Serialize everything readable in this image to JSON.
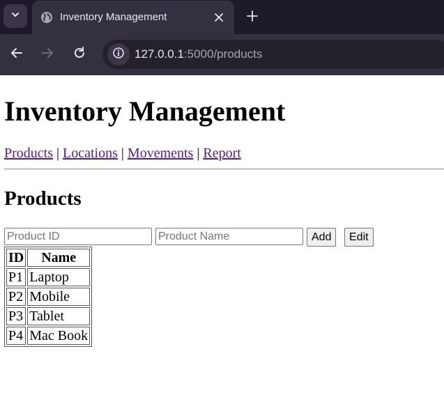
{
  "browser": {
    "tab": {
      "title": "Inventory Management",
      "favicon": "globe-icon"
    },
    "url": {
      "host": "127.0.0.1",
      "path": ":5000/products"
    },
    "colors": {
      "tabbar": "#1f1a29",
      "active_tab": "#35303f",
      "toolbar": "#35303f",
      "omnibox": "#24202c"
    }
  },
  "page": {
    "title": "Inventory Management",
    "nav": {
      "products": "Products",
      "locations": "Locations",
      "movements": "Movements",
      "report": "Report",
      "separator": "|"
    },
    "section_title": "Products",
    "form": {
      "product_id_placeholder": "Product ID",
      "product_name_placeholder": "Product Name",
      "add_label": "Add",
      "edit_label": "Edit"
    },
    "table": {
      "headers": [
        "ID",
        "Name"
      ],
      "rows": [
        [
          "P1",
          "Laptop"
        ],
        [
          "P2",
          "Mobile"
        ],
        [
          "P3",
          "Tablet"
        ],
        [
          "P4",
          "Mac Book"
        ]
      ]
    }
  }
}
